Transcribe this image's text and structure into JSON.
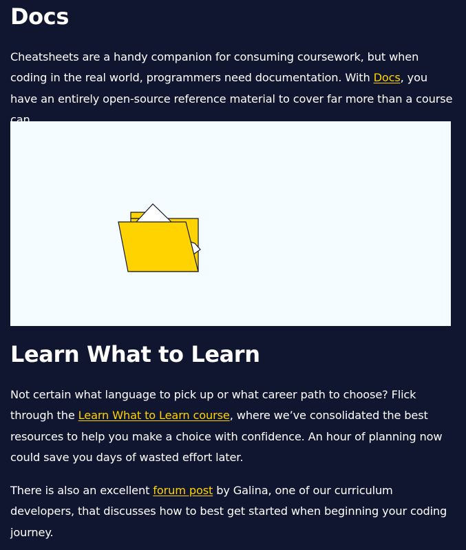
{
  "docs": {
    "heading": "Docs",
    "paragraph": {
      "before_link": "Cheatsheets are a handy companion for consuming coursework, but when coding in the real world, programmers need documentation. With ",
      "link_text": "Docs",
      "after_link": ", you have an entirely open-source reference material to cover far more than a course can."
    },
    "illustration": {
      "icon": "folder-with-documents-icon",
      "background_color": "#f5fcff",
      "folder_color": "#ffd300"
    }
  },
  "learn": {
    "heading": "Learn What to Learn",
    "paragraph": {
      "before_link": "Not certain what language to pick up or what career path to choose? Flick through the ",
      "link_text": "Learn What to Learn course",
      "after_link": ", where we’ve consolidated the best resources to help you make a choice with confidence. An hour of planning now could save you days of wasted effort later."
    },
    "forum_paragraph": {
      "before_link": "There is also an excellent ",
      "link_text": "forum post",
      "after_link": " by Galina, one of our curriculum developers, that discusses how to best get started when beginning your coding journey."
    }
  },
  "colors": {
    "page_background": "#10162f",
    "text": "#ffffff",
    "link": "#ffd300"
  }
}
